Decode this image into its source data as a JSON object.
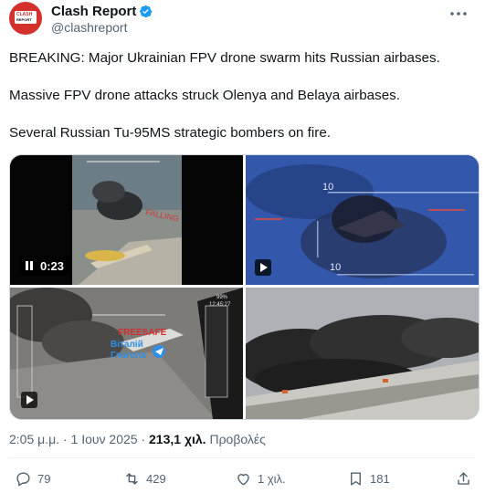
{
  "account": {
    "name": "Clash Report",
    "handle": "@clashreport",
    "avatar_line1": "CLASH",
    "avatar_line2": "REPORT"
  },
  "tweet": {
    "line1": "BREAKING: Major Ukrainian FPV drone swarm hits Russian airbases.",
    "line2": "Massive FPV drone attacks struck Olenya and Belaya airbases.",
    "line3": "Several Russian Tu-95MS strategic bombers on fire."
  },
  "media": {
    "video1_time": "0:23",
    "hud_10_top": "10",
    "hud_10_bottom": "10",
    "overlay_text_1": "Віталій",
    "overlay_text_2": "Глагола",
    "overlay_tag": "FREESAFE",
    "hud_readout": "99%",
    "hud_readout2": "12:45:27"
  },
  "meta": {
    "time": "2:05 μ.μ.",
    "sep1": "·",
    "date": "1 Ιουν 2025",
    "sep2": "·",
    "views": "213,1 χιλ.",
    "views_label": "Προβολές"
  },
  "actions": {
    "replies": "79",
    "reposts": "429",
    "likes": "1 χιλ.",
    "bookmarks": "181"
  },
  "colors": {
    "text": "#0f1419",
    "secondary": "#536471",
    "verified": "#1d9bf0",
    "avatar": "#d4302c"
  }
}
